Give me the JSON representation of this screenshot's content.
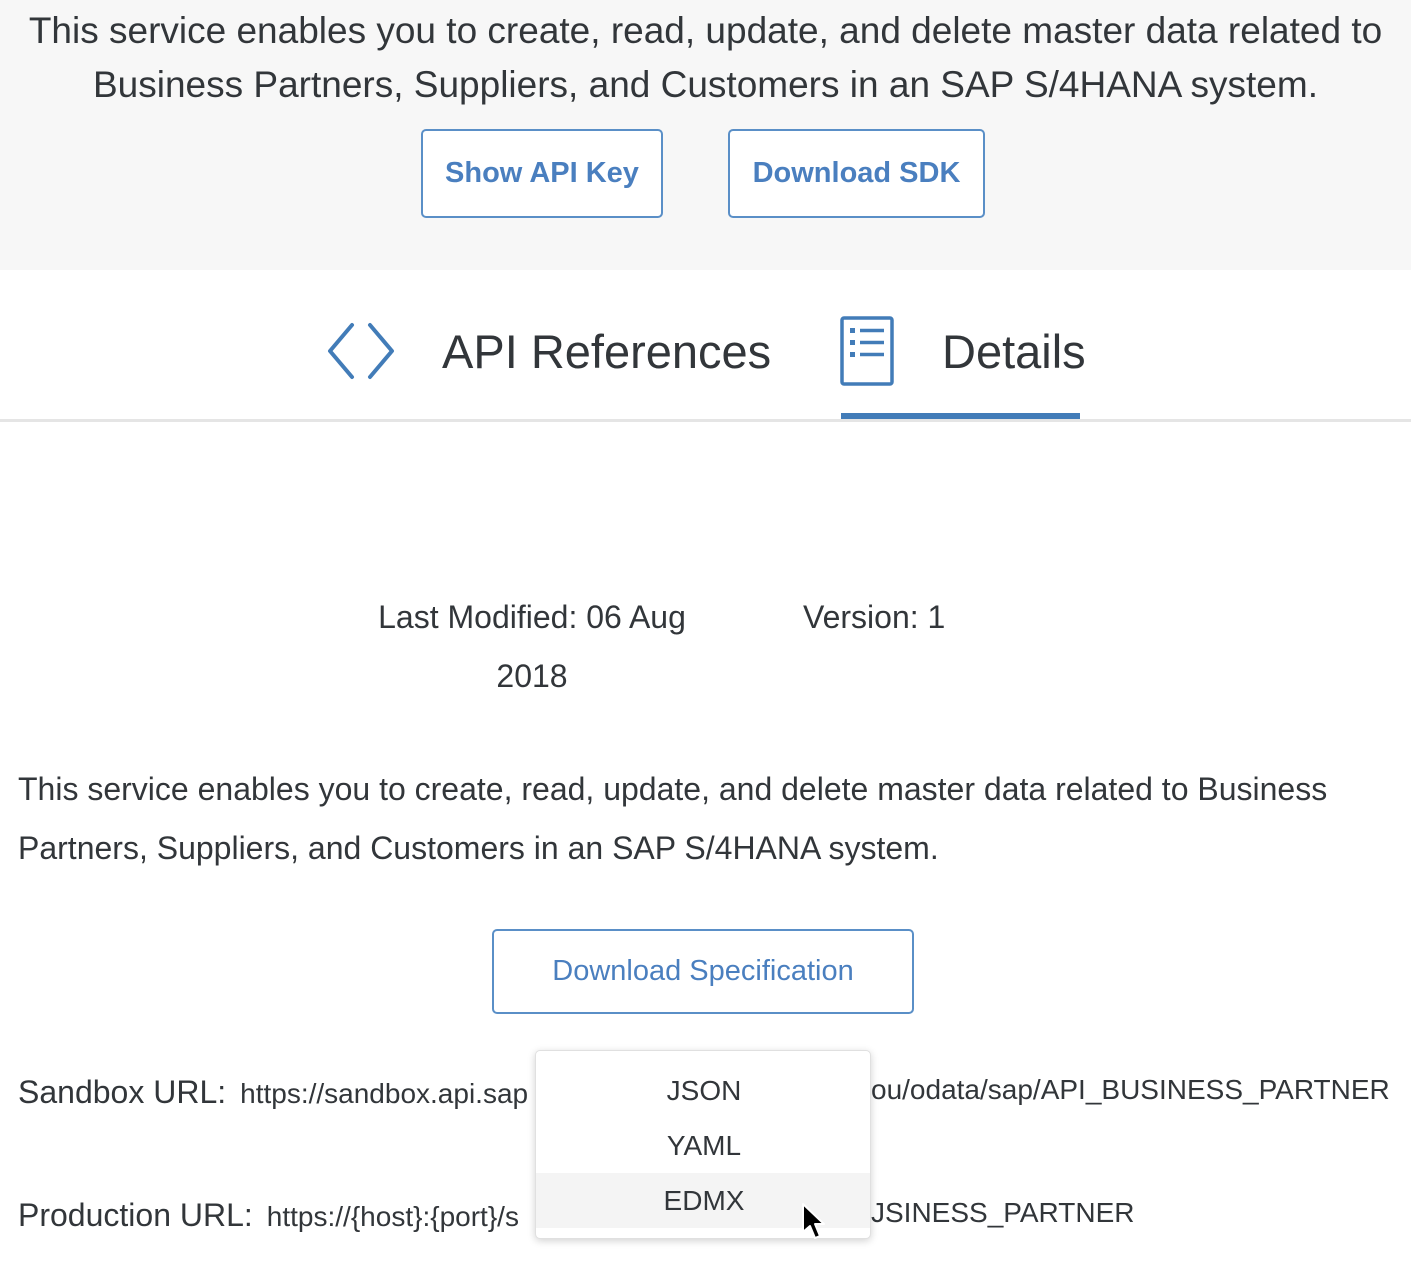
{
  "header": {
    "description": "This service enables you to create, read, update, and delete master data related to Business Partners, Suppliers, and Customers in an SAP S/4HANA system.",
    "show_api_key_label": "Show API Key",
    "download_sdk_label": "Download SDK"
  },
  "tabs": [
    {
      "label": "API References",
      "icon": "code-brackets-icon",
      "selected": false
    },
    {
      "label": "Details",
      "icon": "document-list-icon",
      "selected": true
    }
  ],
  "details": {
    "last_modified": "Last Modified: 06 Aug 2018",
    "version": "Version: 1",
    "description": "This service enables you to create, read, update, and delete master data related to Business Partners, Suppliers, and Customers in an SAP S/4HANA system.",
    "download_spec_label": "Download Specification",
    "sandbox_label": "Sandbox URL:",
    "sandbox_url": "https://sandbox.api.sap",
    "sandbox_url_tail": "ou/odata/sap/API_BUSINESS_PARTNER",
    "production_label": "Production URL:",
    "production_url": "https://{host}:{port}/s",
    "production_url_tail": "JSINESS_PARTNER"
  },
  "dropdown": {
    "options": [
      "JSON",
      "YAML",
      "EDMX"
    ],
    "hovered": "EDMX"
  },
  "colors": {
    "accent": "#427cb8",
    "button_text": "#4a7fbf",
    "text": "#32363a",
    "header_bg": "#f7f7f7"
  }
}
